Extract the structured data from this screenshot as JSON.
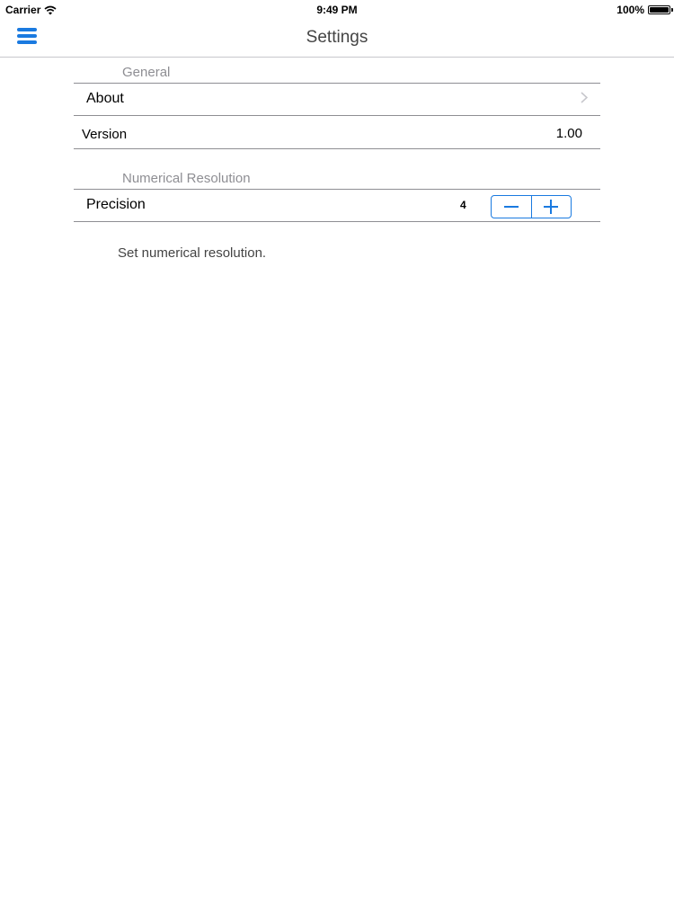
{
  "status_bar": {
    "carrier": "Carrier",
    "time": "9:49 PM",
    "battery": "100%"
  },
  "nav": {
    "title": "Settings",
    "menu_icon": "hamburger-menu-icon"
  },
  "sections": {
    "general": {
      "header": "General",
      "about_label": "About",
      "version_label": "Version",
      "version_value": "1.00"
    },
    "numerical": {
      "header": "Numerical Resolution",
      "precision_label": "Precision",
      "precision_value": "4",
      "footer": "Set numerical resolution."
    }
  },
  "colors": {
    "accent": "#1a7ae0",
    "section_header": "#8e8e93",
    "separator": "#8e8e93"
  }
}
